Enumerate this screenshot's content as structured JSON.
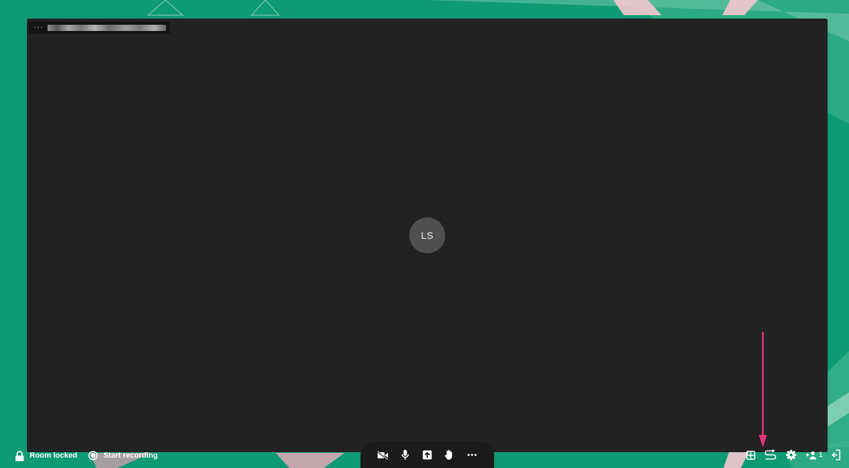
{
  "meeting": {
    "room_status_label": "Room locked",
    "recording_label": "Start recording",
    "participant_initials": "LS",
    "participant_count": "1"
  },
  "toolbar": {
    "buttons": [
      {
        "name": "camera-off",
        "icon": "video-off-icon"
      },
      {
        "name": "microphone",
        "icon": "microphone-icon"
      },
      {
        "name": "share-screen",
        "icon": "share-screen-icon"
      },
      {
        "name": "raise-hand",
        "icon": "hand-icon"
      },
      {
        "name": "more-options",
        "icon": "ellipsis-icon"
      }
    ]
  },
  "right_controls": [
    "grid-view-icon",
    "switch-view-icon",
    "settings-icon",
    "participants-icon",
    "leave-icon"
  ],
  "colors": {
    "background_green": "#0e9a72",
    "video_background": "#222222",
    "toolbar": "#1b1b1b",
    "annotation_arrow": "#e8337a"
  }
}
